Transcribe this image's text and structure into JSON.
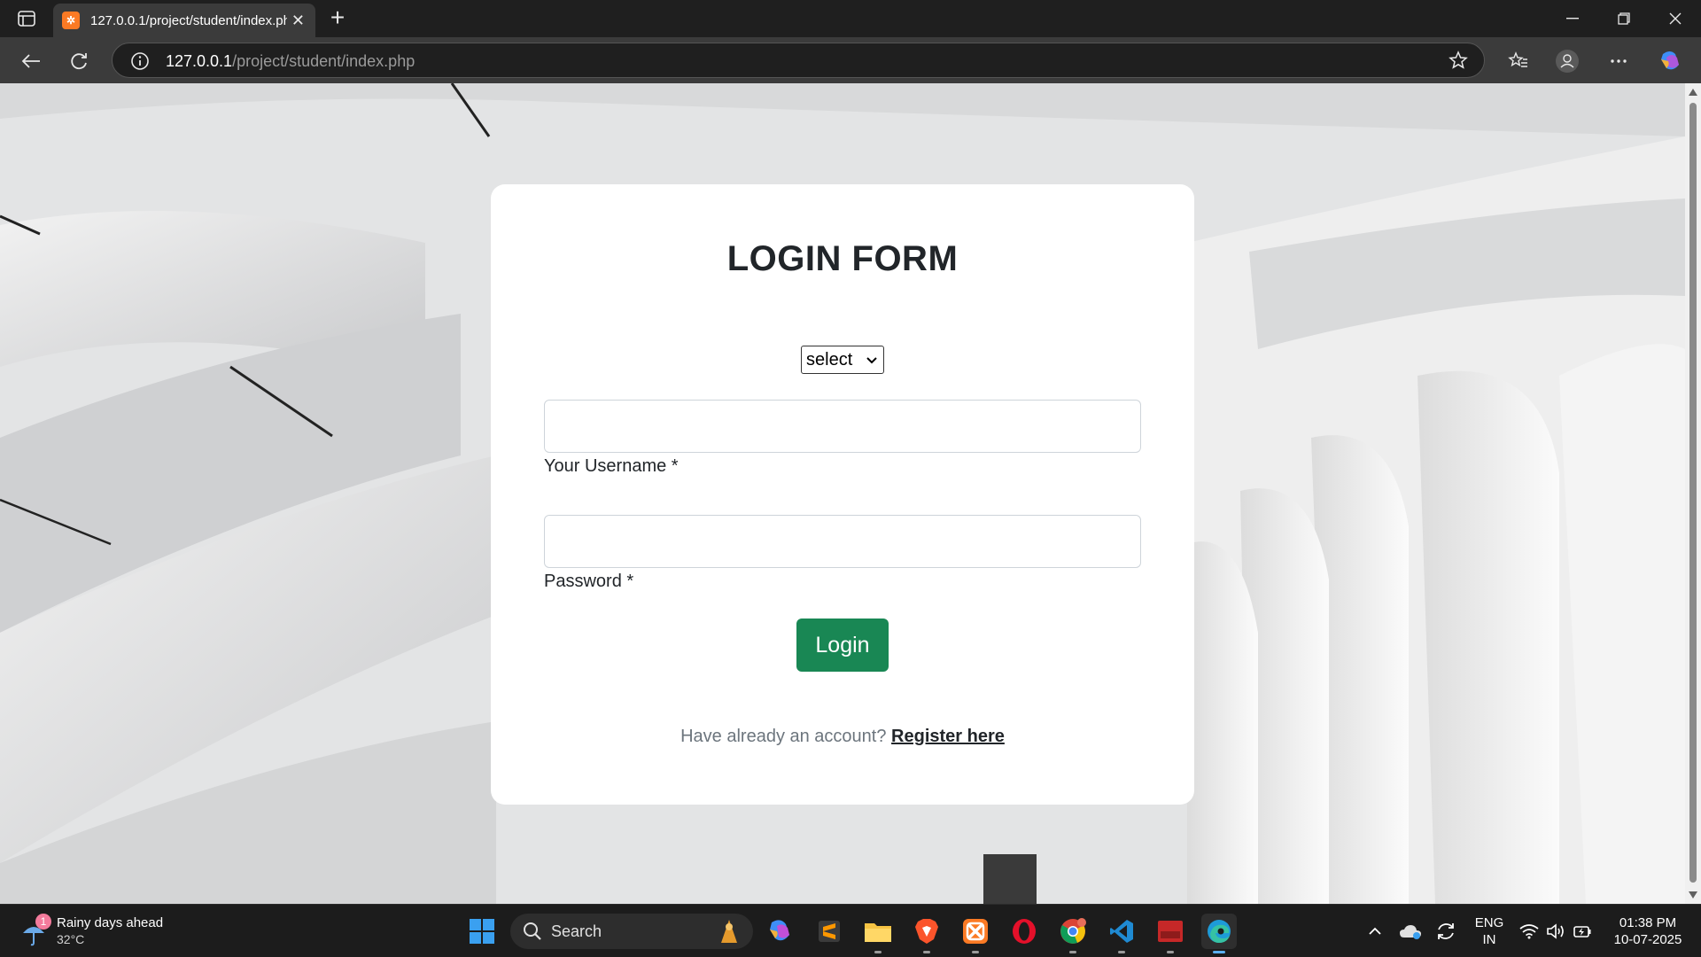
{
  "browser": {
    "tab_title": "127.0.0.1/project/student/index.php",
    "url_host": "127.0.0.1",
    "url_path": "/project/student/index.php"
  },
  "form": {
    "title": "LOGIN FORM",
    "role_select_value": "select",
    "username_label": "Your Username *",
    "password_label": "Password *",
    "login_button": "Login",
    "register_prompt": "Have already an account?",
    "register_link": "Register here"
  },
  "taskbar": {
    "weather_badge": "1",
    "weather_title": "Rainy days ahead",
    "weather_temp": "32°C",
    "search_label": "Search",
    "lang_top": "ENG",
    "lang_bottom": "IN",
    "time": "01:38 PM",
    "date": "10-07-2025"
  },
  "colors": {
    "login_button": "#198754",
    "card_background": "#ffffff",
    "tab_favicon": "#fb7a24"
  }
}
